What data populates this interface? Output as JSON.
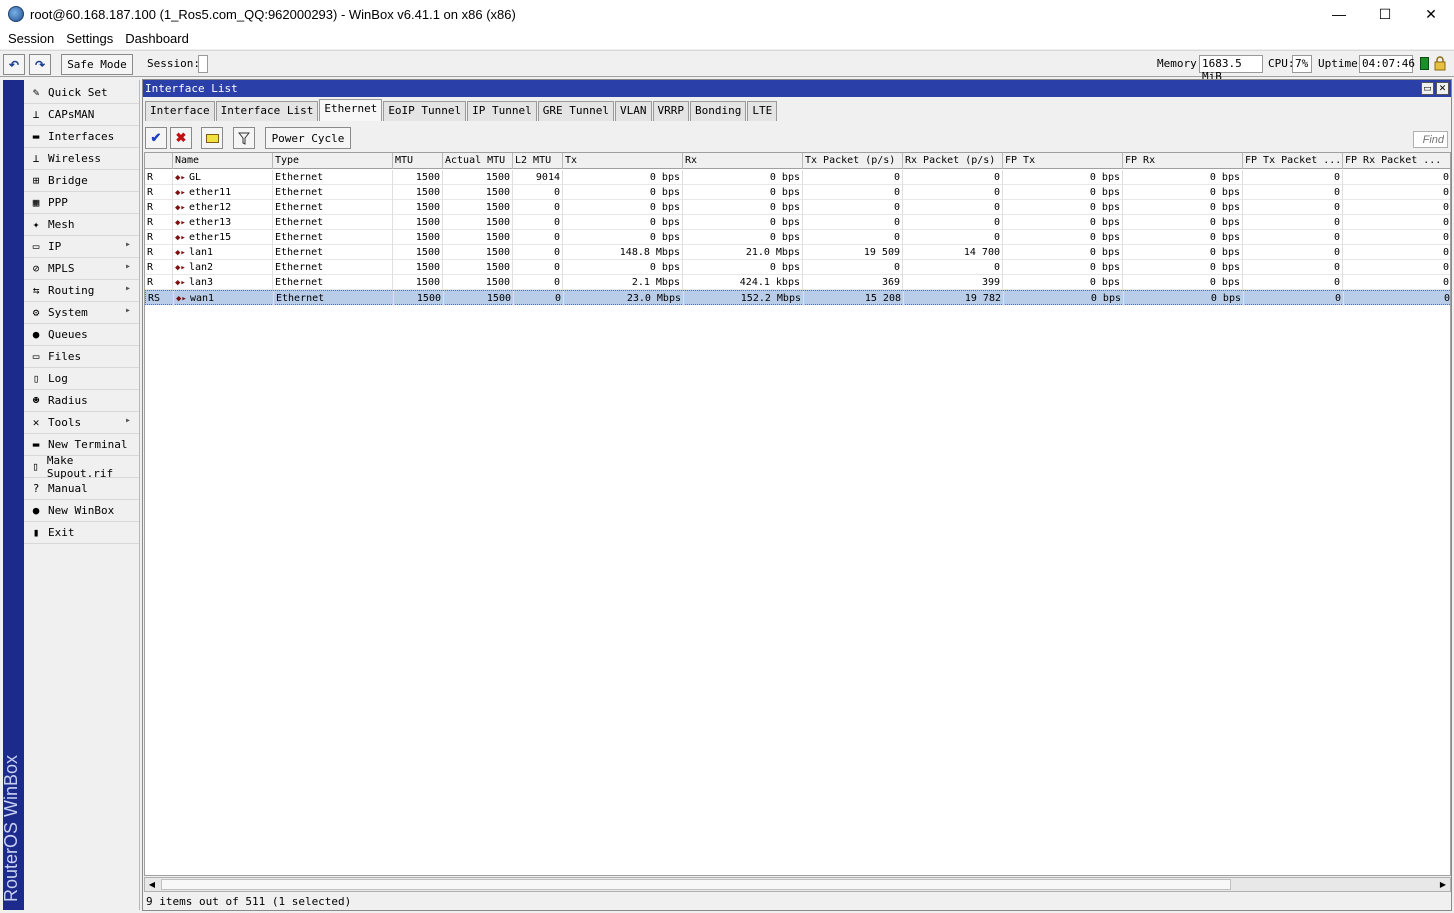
{
  "window": {
    "title": "root@60.168.187.100 (1_Ros5.com_QQ:962000293) - WinBox v6.41.1 on x86 (x86)",
    "minimize": "—",
    "maximize": "☐",
    "close": "✕"
  },
  "menu": [
    "Session",
    "Settings",
    "Dashboard"
  ],
  "toolbar": {
    "undo": "↶",
    "redo": "↷",
    "safe_mode": "Safe Mode",
    "session_label": "Session:",
    "memory_label": "Memory:",
    "memory_value": "1683.5 MiB",
    "cpu_label": "CPU:",
    "cpu_value": "7%",
    "uptime_label": "Uptime:",
    "uptime_value": "04:07:46"
  },
  "brand": "RouterOS WinBox",
  "sidebar": [
    {
      "label": "Quick Set",
      "icon": "quickset-icon",
      "glyph": "✎",
      "arrow": false
    },
    {
      "label": "CAPsMAN",
      "icon": "capsman-icon",
      "glyph": "⊥",
      "arrow": false
    },
    {
      "label": "Interfaces",
      "icon": "interfaces-icon",
      "glyph": "▬",
      "arrow": false
    },
    {
      "label": "Wireless",
      "icon": "wireless-icon",
      "glyph": "⊥",
      "arrow": false
    },
    {
      "label": "Bridge",
      "icon": "bridge-icon",
      "glyph": "⊞",
      "arrow": false
    },
    {
      "label": "PPP",
      "icon": "ppp-icon",
      "glyph": "▦",
      "arrow": false
    },
    {
      "label": "Mesh",
      "icon": "mesh-icon",
      "glyph": "✦",
      "arrow": false
    },
    {
      "label": "IP",
      "icon": "ip-icon",
      "glyph": "▭",
      "arrow": true
    },
    {
      "label": "MPLS",
      "icon": "mpls-icon",
      "glyph": "⊘",
      "arrow": true
    },
    {
      "label": "Routing",
      "icon": "routing-icon",
      "glyph": "⇆",
      "arrow": true
    },
    {
      "label": "System",
      "icon": "system-icon",
      "glyph": "⚙",
      "arrow": true
    },
    {
      "label": "Queues",
      "icon": "queues-icon",
      "glyph": "●",
      "arrow": false
    },
    {
      "label": "Files",
      "icon": "files-icon",
      "glyph": "▭",
      "arrow": false
    },
    {
      "label": "Log",
      "icon": "log-icon",
      "glyph": "▯",
      "arrow": false
    },
    {
      "label": "Radius",
      "icon": "radius-icon",
      "glyph": "☻",
      "arrow": false
    },
    {
      "label": "Tools",
      "icon": "tools-icon",
      "glyph": "✕",
      "arrow": true
    },
    {
      "label": "New Terminal",
      "icon": "terminal-icon",
      "glyph": "▬",
      "arrow": false
    },
    {
      "label": "Make Supout.rif",
      "icon": "supout-icon",
      "glyph": "▯",
      "arrow": false
    },
    {
      "label": "Manual",
      "icon": "manual-icon",
      "glyph": "?",
      "arrow": false
    },
    {
      "label": "New WinBox",
      "icon": "winbox-icon",
      "glyph": "●",
      "arrow": false
    },
    {
      "label": "Exit",
      "icon": "exit-icon",
      "glyph": "▮",
      "arrow": false
    }
  ],
  "panel": {
    "title": "Interface List",
    "tabs": [
      "Interface",
      "Interface List",
      "Ethernet",
      "EoIP Tunnel",
      "IP Tunnel",
      "GRE Tunnel",
      "VLAN",
      "VRRP",
      "Bonding",
      "LTE"
    ],
    "active_tab": "Ethernet",
    "power_cycle": "Power Cycle",
    "find_placeholder": "Find",
    "status": "9 items out of 511 (1 selected)"
  },
  "table": {
    "columns": [
      "",
      "Name",
      "Type",
      "MTU",
      "Actual MTU",
      "L2 MTU",
      "Tx",
      "Rx",
      "Tx Packet (p/s)",
      "Rx Packet (p/s)",
      "FP Tx",
      "FP Rx",
      "FP Tx Packet ...",
      "FP Rx Packet ..."
    ],
    "rows": [
      {
        "flag": "R",
        "name": "GL",
        "type": "Ethernet",
        "mtu": "1500",
        "actual_mtu": "1500",
        "l2_mtu": "9014",
        "tx": "0 bps",
        "rx": "0 bps",
        "tx_pkt": "0",
        "rx_pkt": "0",
        "fp_tx": "0 bps",
        "fp_rx": "0 bps",
        "fp_tx_pkt": "0",
        "fp_rx_pkt": "0",
        "selected": false
      },
      {
        "flag": "R",
        "name": "ether11",
        "type": "Ethernet",
        "mtu": "1500",
        "actual_mtu": "1500",
        "l2_mtu": "0",
        "tx": "0 bps",
        "rx": "0 bps",
        "tx_pkt": "0",
        "rx_pkt": "0",
        "fp_tx": "0 bps",
        "fp_rx": "0 bps",
        "fp_tx_pkt": "0",
        "fp_rx_pkt": "0",
        "selected": false
      },
      {
        "flag": "R",
        "name": "ether12",
        "type": "Ethernet",
        "mtu": "1500",
        "actual_mtu": "1500",
        "l2_mtu": "0",
        "tx": "0 bps",
        "rx": "0 bps",
        "tx_pkt": "0",
        "rx_pkt": "0",
        "fp_tx": "0 bps",
        "fp_rx": "0 bps",
        "fp_tx_pkt": "0",
        "fp_rx_pkt": "0",
        "selected": false
      },
      {
        "flag": "R",
        "name": "ether13",
        "type": "Ethernet",
        "mtu": "1500",
        "actual_mtu": "1500",
        "l2_mtu": "0",
        "tx": "0 bps",
        "rx": "0 bps",
        "tx_pkt": "0",
        "rx_pkt": "0",
        "fp_tx": "0 bps",
        "fp_rx": "0 bps",
        "fp_tx_pkt": "0",
        "fp_rx_pkt": "0",
        "selected": false
      },
      {
        "flag": "R",
        "name": "ether15",
        "type": "Ethernet",
        "mtu": "1500",
        "actual_mtu": "1500",
        "l2_mtu": "0",
        "tx": "0 bps",
        "rx": "0 bps",
        "tx_pkt": "0",
        "rx_pkt": "0",
        "fp_tx": "0 bps",
        "fp_rx": "0 bps",
        "fp_tx_pkt": "0",
        "fp_rx_pkt": "0",
        "selected": false
      },
      {
        "flag": "R",
        "name": "lan1",
        "type": "Ethernet",
        "mtu": "1500",
        "actual_mtu": "1500",
        "l2_mtu": "0",
        "tx": "148.8 Mbps",
        "rx": "21.0 Mbps",
        "tx_pkt": "19 509",
        "rx_pkt": "14 700",
        "fp_tx": "0 bps",
        "fp_rx": "0 bps",
        "fp_tx_pkt": "0",
        "fp_rx_pkt": "0",
        "selected": false
      },
      {
        "flag": "R",
        "name": "lan2",
        "type": "Ethernet",
        "mtu": "1500",
        "actual_mtu": "1500",
        "l2_mtu": "0",
        "tx": "0 bps",
        "rx": "0 bps",
        "tx_pkt": "0",
        "rx_pkt": "0",
        "fp_tx": "0 bps",
        "fp_rx": "0 bps",
        "fp_tx_pkt": "0",
        "fp_rx_pkt": "0",
        "selected": false
      },
      {
        "flag": "R",
        "name": "lan3",
        "type": "Ethernet",
        "mtu": "1500",
        "actual_mtu": "1500",
        "l2_mtu": "0",
        "tx": "2.1 Mbps",
        "rx": "424.1 kbps",
        "tx_pkt": "369",
        "rx_pkt": "399",
        "fp_tx": "0 bps",
        "fp_rx": "0 bps",
        "fp_tx_pkt": "0",
        "fp_rx_pkt": "0",
        "selected": false
      },
      {
        "flag": "RS",
        "name": "wan1",
        "type": "Ethernet",
        "mtu": "1500",
        "actual_mtu": "1500",
        "l2_mtu": "0",
        "tx": "23.0 Mbps",
        "rx": "152.2 Mbps",
        "tx_pkt": "15 208",
        "rx_pkt": "19 782",
        "fp_tx": "0 bps",
        "fp_rx": "0 bps",
        "fp_tx_pkt": "0",
        "fp_rx_pkt": "0",
        "selected": true
      }
    ]
  },
  "colors": {
    "title_bar": "#2b3fa8",
    "brand_bar": "#1c2a8c",
    "selection": "#b9cde9"
  }
}
